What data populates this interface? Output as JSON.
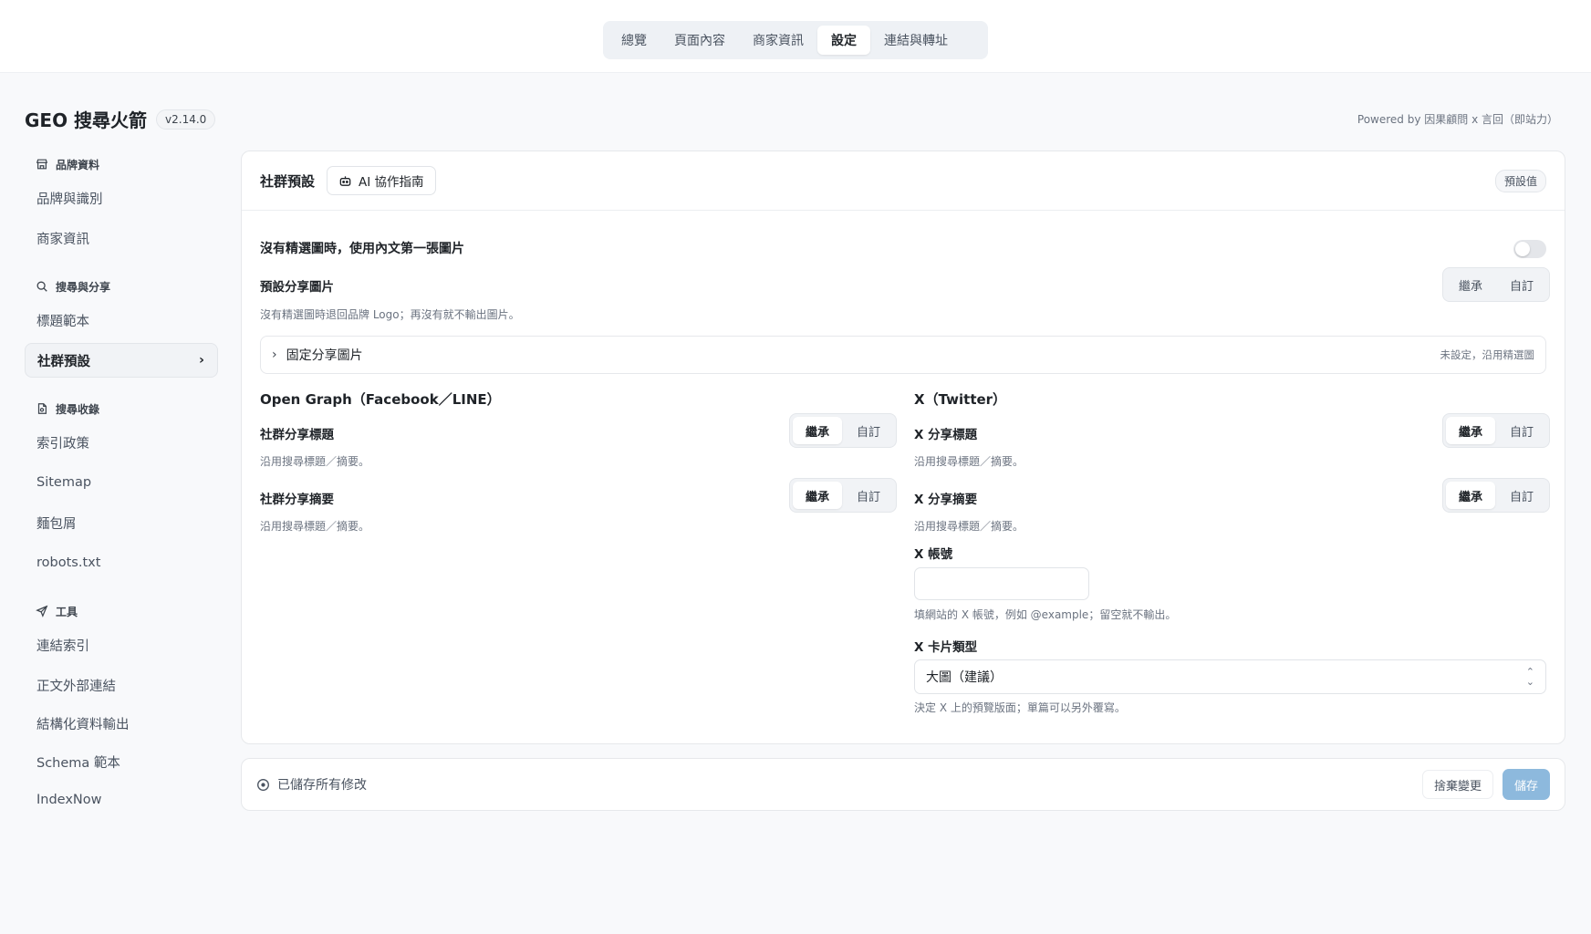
{
  "topnav": {
    "tabs": [
      {
        "label": "總覽"
      },
      {
        "label": "頁面內容"
      },
      {
        "label": "商家資訊"
      },
      {
        "label": "設定"
      },
      {
        "label": "連結與轉址"
      }
    ],
    "active_index": 3
  },
  "header": {
    "title": "GEO 搜尋火箭",
    "version": "v2.14.0",
    "powered_by": "Powered by 因果顧問 x 言回（即站力）"
  },
  "sidebar": {
    "groups": [
      {
        "label": "品牌資料",
        "icon": "store-icon",
        "items": [
          "品牌與識別",
          "商家資訊"
        ]
      },
      {
        "label": "搜尋與分享",
        "icon": "search-icon",
        "items": [
          "標題範本",
          "社群預設"
        ]
      },
      {
        "label": "搜尋收錄",
        "icon": "document-icon",
        "items": [
          "索引政策",
          "Sitemap",
          "麵包屑",
          "robots.txt"
        ]
      },
      {
        "label": "工具",
        "icon": "send-icon",
        "items": [
          "連結索引",
          "正文外部連結",
          "結構化資料輸出",
          "Schema 範本",
          "IndexNow"
        ]
      }
    ],
    "active_item": "社群預設"
  },
  "card": {
    "title": "社群預設",
    "ai_button": "AI 協作指南",
    "default_badge": "預設值",
    "toggle_label": "沒有精選圖時，使用內文第一張圖片",
    "toggle_on": false,
    "share_image": {
      "label": "預設分享圖片",
      "help": "沒有精選圖時退回品牌 Logo；再沒有就不輸出圖片。",
      "options": [
        "繼承",
        "自訂"
      ],
      "selected": null
    },
    "fixed_image": {
      "label": "固定分享圖片",
      "status": "未設定，沿用精選圖"
    },
    "og": {
      "title": "Open Graph（Facebook／LINE）",
      "share_title": {
        "label": "社群分享標題",
        "help": "沿用搜尋標題／摘要。",
        "options": [
          "繼承",
          "自訂"
        ],
        "selected": "繼承"
      },
      "share_desc": {
        "label": "社群分享摘要",
        "help": "沿用搜尋標題／摘要。",
        "options": [
          "繼承",
          "自訂"
        ],
        "selected": "繼承"
      }
    },
    "x": {
      "title": "X（Twitter）",
      "share_title": {
        "label": "X 分享標題",
        "help": "沿用搜尋標題／摘要。",
        "options": [
          "繼承",
          "自訂"
        ],
        "selected": "繼承"
      },
      "share_desc": {
        "label": "X 分享摘要",
        "help": "沿用搜尋標題／摘要。",
        "options": [
          "繼承",
          "自訂"
        ],
        "selected": "繼承"
      },
      "account": {
        "label": "X 帳號",
        "value": "",
        "help": "填網站的 X 帳號，例如 @example；留空就不輸出。"
      },
      "card_type": {
        "label": "X 卡片類型",
        "value": "大圖（建議）",
        "help": "決定 X 上的預覽版面；單篇可以另外覆寫。"
      }
    }
  },
  "savebar": {
    "status": "已儲存所有修改",
    "discard": "捨棄變更",
    "save": "儲存"
  },
  "colors": {
    "accent_save": "#8db9dd",
    "background": "#f8f9fb"
  }
}
